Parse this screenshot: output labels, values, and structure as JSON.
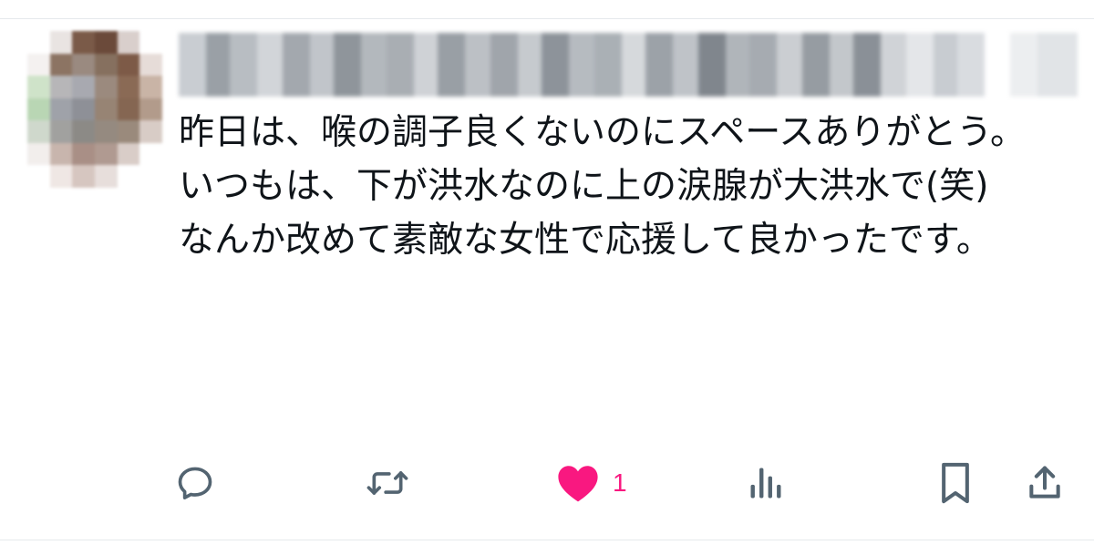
{
  "tweet": {
    "text": "昨日は、喉の調子良くないのにスペースありがとう。\nいつもは、下が洪水なのに上の涙腺が大洪水で(笑)\nなんか改めて素敵な女性で応援して良かったです。"
  },
  "actions": {
    "reply_icon": "reply-icon",
    "retweet_icon": "retweet-icon",
    "like_icon": "heart-filled-icon",
    "like_count": "1",
    "views_icon": "views-icon",
    "bookmark_icon": "bookmark-icon",
    "share_icon": "share-icon"
  },
  "colors": {
    "text": "#0f1419",
    "icon_gray": "#536471",
    "like_pink": "#f91880",
    "divider": "#e6e9ec"
  }
}
